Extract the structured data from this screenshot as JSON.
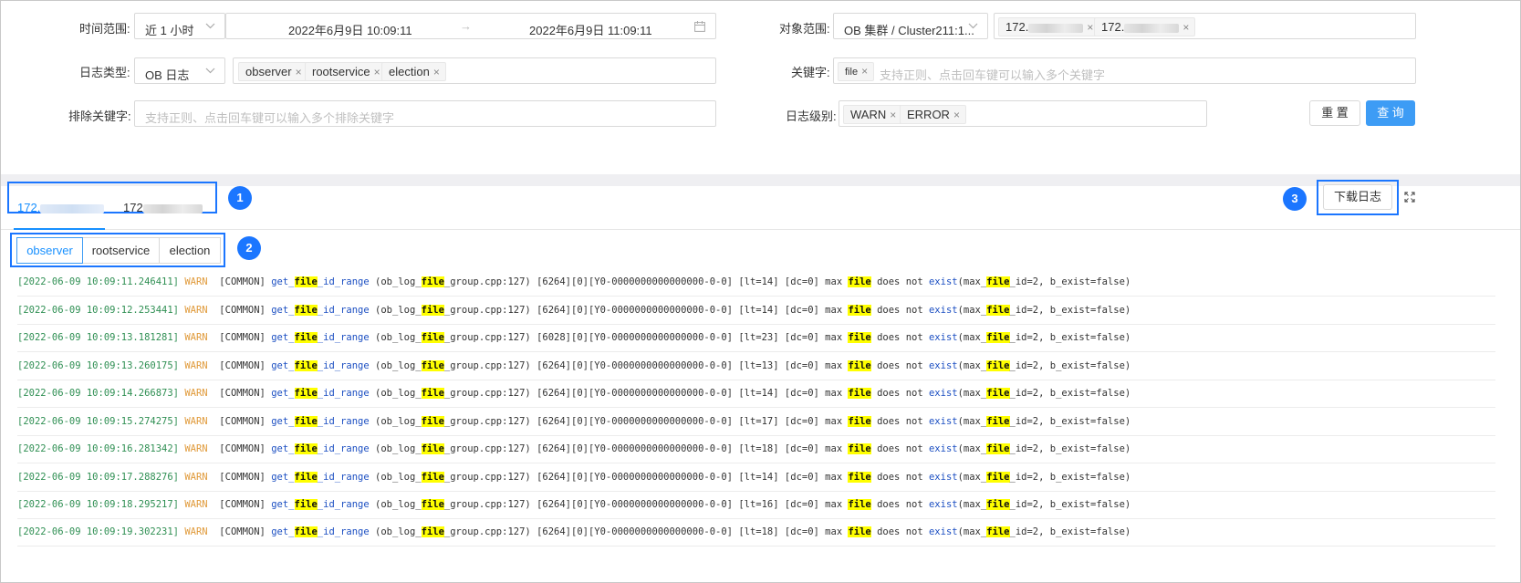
{
  "filters": {
    "time_range": {
      "label": "时间范围:",
      "preset": "近 1 小时",
      "start": "2022年6月9日 10:09:11",
      "arrow": "→",
      "end": "2022年6月9日 11:09:11"
    },
    "object_scope": {
      "label": "对象范围:",
      "value": "OB 集群 / Cluster211:1...",
      "hosts": [
        "172.",
        "172."
      ]
    },
    "log_type": {
      "label": "日志类型:",
      "value": "OB 日志",
      "tags": [
        "observer",
        "rootservice",
        "election"
      ]
    },
    "keyword": {
      "label": "关键字:",
      "tag": "file",
      "placeholder": "支持正则、点击回车键可以输入多个关键字"
    },
    "exclude_keyword": {
      "label": "排除关键字:",
      "placeholder": "支持正则、点击回车键可以输入多个排除关键字"
    },
    "log_level": {
      "label": "日志级别:",
      "tags": [
        "WARN",
        "ERROR"
      ]
    },
    "reset_label": "重 置",
    "query_label": "查 询",
    "tag_close": "×"
  },
  "host_tabs": [
    "172.",
    "172"
  ],
  "component_tabs": [
    "observer",
    "rootservice",
    "election"
  ],
  "badges": [
    "1",
    "2",
    "3"
  ],
  "download_label": "下载日志",
  "logs": [
    {
      "ts": "[2022-06-09 10:09:11.246411]",
      "level": "WARN",
      "mod": "[COMMON]",
      "tid": "[6264]",
      "lt": "[lt=14]"
    },
    {
      "ts": "[2022-06-09 10:09:12.253441]",
      "level": "WARN",
      "mod": "[COMMON]",
      "tid": "[6264]",
      "lt": "[lt=14]"
    },
    {
      "ts": "[2022-06-09 10:09:13.181281]",
      "level": "WARN",
      "mod": "[COMMON]",
      "tid": "[6028]",
      "lt": "[lt=23]"
    },
    {
      "ts": "[2022-06-09 10:09:13.260175]",
      "level": "WARN",
      "mod": "[COMMON]",
      "tid": "[6264]",
      "lt": "[lt=13]"
    },
    {
      "ts": "[2022-06-09 10:09:14.266873]",
      "level": "WARN",
      "mod": "[COMMON]",
      "tid": "[6264]",
      "lt": "[lt=14]"
    },
    {
      "ts": "[2022-06-09 10:09:15.274275]",
      "level": "WARN",
      "mod": "[COMMON]",
      "tid": "[6264]",
      "lt": "[lt=17]"
    },
    {
      "ts": "[2022-06-09 10:09:16.281342]",
      "level": "WARN",
      "mod": "[COMMON]",
      "tid": "[6264]",
      "lt": "[lt=18]"
    },
    {
      "ts": "[2022-06-09 10:09:17.288276]",
      "level": "WARN",
      "mod": "[COMMON]",
      "tid": "[6264]",
      "lt": "[lt=14]"
    },
    {
      "ts": "[2022-06-09 10:09:18.295217]",
      "level": "WARN",
      "mod": "[COMMON]",
      "tid": "[6264]",
      "lt": "[lt=16]"
    },
    {
      "ts": "[2022-06-09 10:09:19.302231]",
      "level": "WARN",
      "mod": "[COMMON]",
      "tid": "[6264]",
      "lt": "[lt=18]"
    }
  ],
  "log_parts": {
    "fn_pre": "get_",
    "fn_kw": "file",
    "fn_post": "_id_range",
    "src_pre": " (ob_log_",
    "src_kw": "file",
    "src_post": "_group.cpp:127) ",
    "trace": "[0][Y0-0000000000000000-0-0] ",
    "dc": "[dc=0] max ",
    "kw": "file",
    "mid": " does not ",
    "exist": "exist",
    "args_pre": "(max_",
    "args_kw": "file",
    "args_post": "_id=2, b_exist=false)"
  },
  "colors": {
    "accent": "#1890ff",
    "highlight_box": "#1b76ff",
    "primary_button": "#3d9cf5",
    "keyword_highlight": "#ffff00",
    "timestamp": "#2f8f53",
    "level_warn": "#e09a3a",
    "function": "#1c4fc2"
  },
  "icons": [
    "chevron-down-icon",
    "calendar-icon",
    "expand-icon"
  ]
}
